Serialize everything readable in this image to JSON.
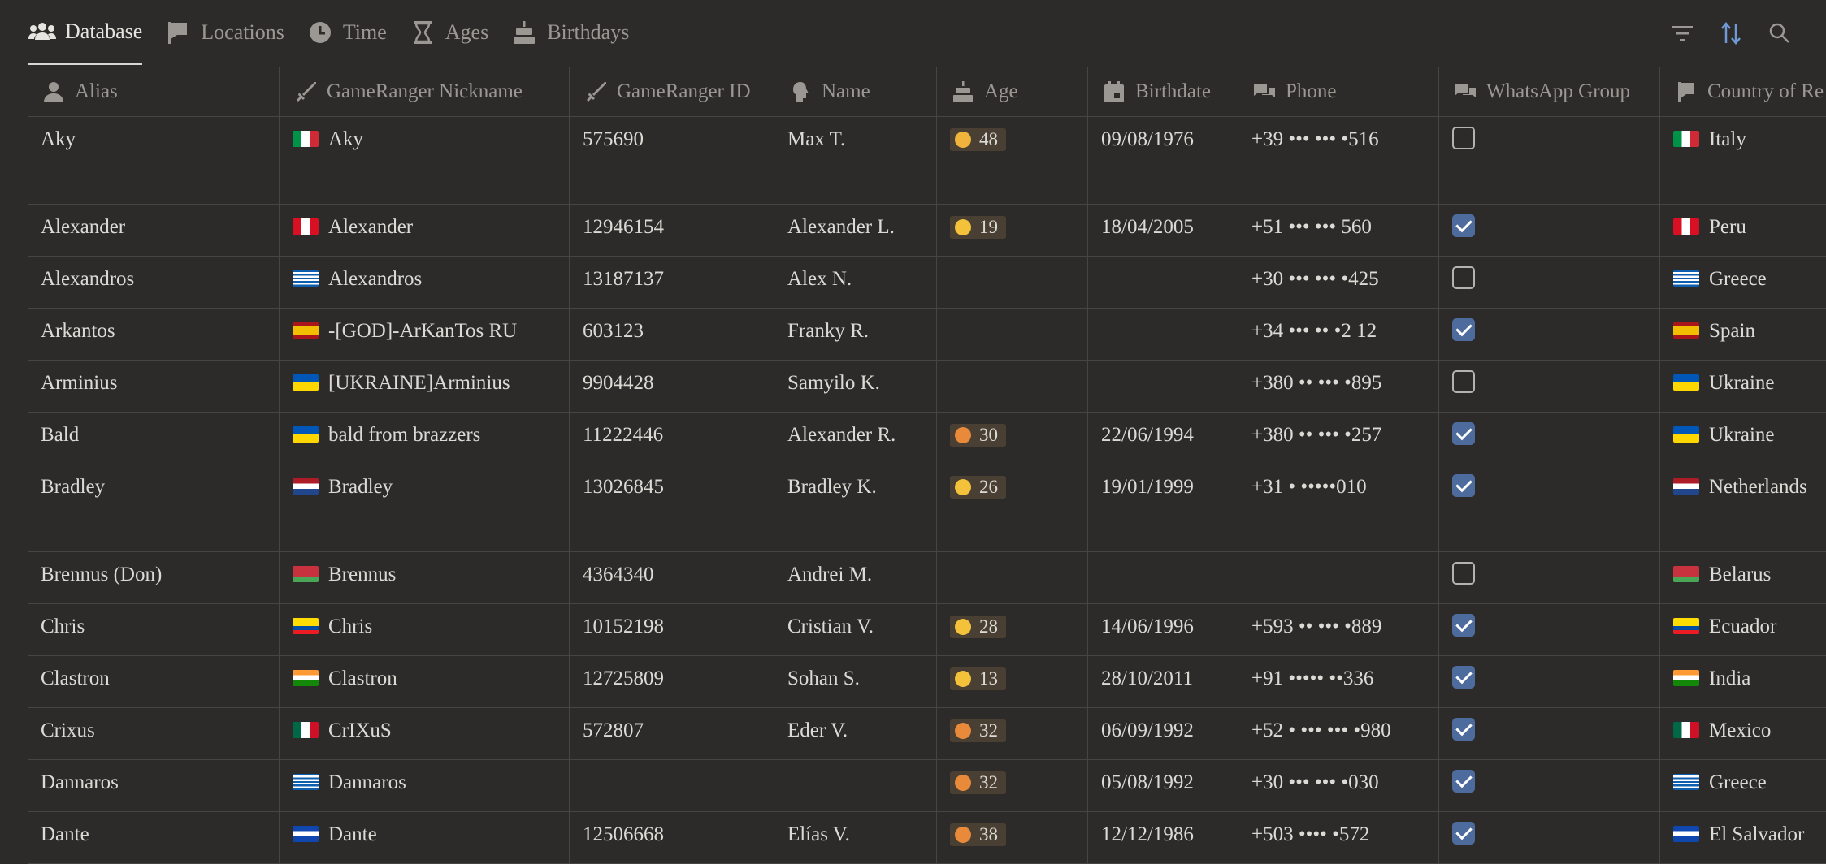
{
  "tabs": [
    {
      "label": "Database",
      "icon": "people-icon"
    },
    {
      "label": "Locations",
      "icon": "flag-icon"
    },
    {
      "label": "Time",
      "icon": "clock-icon"
    },
    {
      "label": "Ages",
      "icon": "hourglass-icon"
    },
    {
      "label": "Birthdays",
      "icon": "cake-icon"
    }
  ],
  "toolbar": {
    "filter": "filter-icon",
    "sort": "sort-icon",
    "search": "search-icon"
  },
  "columns": [
    {
      "label": "Alias",
      "icon": "person-icon"
    },
    {
      "label": "GameRanger Nickname",
      "icon": "sword-icon"
    },
    {
      "label": "GameRanger ID",
      "icon": "sword-icon"
    },
    {
      "label": "Name",
      "icon": "head-icon"
    },
    {
      "label": "Age",
      "icon": "cake-icon"
    },
    {
      "label": "Birthdate",
      "icon": "calendar-icon"
    },
    {
      "label": "Phone",
      "icon": "chat-icon"
    },
    {
      "label": "WhatsApp Group",
      "icon": "chat-icon"
    },
    {
      "label": "Country of Re",
      "icon": "flag-icon"
    }
  ],
  "rows": [
    {
      "alias": "Aky",
      "nick": "Aky",
      "grid": "575690",
      "name": "Max T.",
      "age": "48",
      "birth": "09/08/1976",
      "phone": "+39 ••• ••• •516",
      "wa": false,
      "country": "Italy"
    },
    {
      "alias": "Alexander",
      "nick": "Alexander",
      "grid": "12946154",
      "name": "Alexander L.",
      "age": "19",
      "birth": "18/04/2005",
      "phone": "+51 ••• ••• 560",
      "wa": true,
      "country": "Peru"
    },
    {
      "alias": "Alexandros",
      "nick": "Alexandros",
      "grid": "13187137",
      "name": "Alex N.",
      "age": "",
      "birth": "",
      "phone": "+30 ••• ••• •425",
      "wa": false,
      "country": "Greece"
    },
    {
      "alias": "Arkantos",
      "nick": "-[GOD]-ArKanTos RU",
      "grid": "603123",
      "name": "Franky R.",
      "age": "",
      "birth": "",
      "phone": "+34 ••• •• •2 12",
      "wa": true,
      "country": "Spain"
    },
    {
      "alias": "Arminius",
      "nick": "[UKRAINE]Arminius",
      "grid": "9904428",
      "name": "Samyilo K.",
      "age": "",
      "birth": "",
      "phone": "+380 •• ••• •895",
      "wa": false,
      "country": "Ukraine"
    },
    {
      "alias": "Bald",
      "nick": "bald from brazzers",
      "grid": "11222446",
      "name": "Alexander R.",
      "age": "30",
      "birth": "22/06/1994",
      "phone": "+380 •• ••• •257",
      "wa": true,
      "country": "Ukraine"
    },
    {
      "alias": "Bradley",
      "nick": "Bradley",
      "grid": "13026845",
      "name": "Bradley K.",
      "age": "26",
      "birth": "19/01/1999",
      "phone": "+31 • •••••010",
      "wa": true,
      "country": "Netherlands"
    },
    {
      "alias": "Brennus (Don)",
      "nick": "Brennus",
      "grid": "4364340",
      "name": "Andrei M.",
      "age": "",
      "birth": "",
      "phone": "",
      "wa": false,
      "country": "Belarus"
    },
    {
      "alias": "Chris",
      "nick": "Chris",
      "grid": "10152198",
      "name": "Cristian V.",
      "age": "28",
      "birth": "14/06/1996",
      "phone": "+593 •• ••• •889",
      "wa": true,
      "country": "Ecuador"
    },
    {
      "alias": "Clastron",
      "nick": "Clastron",
      "grid": "12725809",
      "name": "Sohan S.",
      "age": "13",
      "birth": "28/10/2011",
      "phone": "+91 ••••• ••336",
      "wa": true,
      "country": "India"
    },
    {
      "alias": "Crixus",
      "nick": "CrIXuS",
      "grid": "572807",
      "name": "Eder V.",
      "age": "32",
      "birth": "06/09/1992",
      "phone": "+52 • ••• ••• •980",
      "wa": true,
      "country": "Mexico"
    },
    {
      "alias": "Dannaros",
      "nick": "Dannaros",
      "grid": "",
      "name": "",
      "age": "32",
      "birth": "05/08/1992",
      "phone": "+30 ••• ••• •030",
      "wa": true,
      "country": "Greece"
    },
    {
      "alias": "Dante",
      "nick": "Dante",
      "grid": "12506668",
      "name": "Elías V.",
      "age": "38",
      "birth": "12/12/1986",
      "phone": "+503 •••• •572",
      "wa": true,
      "country": "El Salvador"
    }
  ]
}
